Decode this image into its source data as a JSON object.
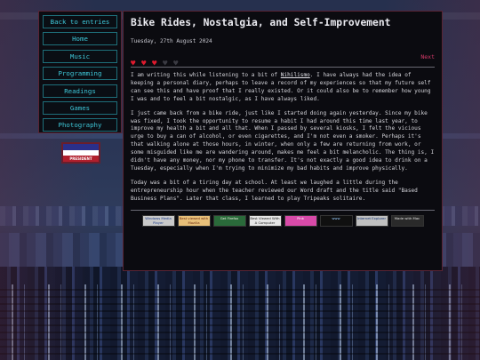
{
  "sidebar": {
    "items": [
      {
        "label": "Back to entries"
      },
      {
        "label": "Home"
      },
      {
        "label": "Music"
      },
      {
        "label": "Programming"
      },
      {
        "label": "Readings"
      },
      {
        "label": "Games"
      },
      {
        "label": "Photography"
      }
    ],
    "badge_text": "PRESIDENT"
  },
  "post": {
    "title": "Bike Rides, Nostalgia, and Self-Improvement",
    "date": "Tuesday, 27th August 2024",
    "rating": {
      "filled": 3,
      "total": 5
    },
    "next_label": "Next",
    "p1_a": "I am writing this while listening to a bit of ",
    "p1_link": "Nihilismo",
    "p1_b": ". I have always had the idea of keeping a personal diary, perhaps to leave a record of my experiences so that my future self can see this and have proof that I really existed. Or it could also be to remember how young I was and to feel a bit nostalgic, as I have always liked.",
    "p2": "I just came back from a bike ride, just like I started doing again yesterday. Since my bike was fixed, I took the opportunity to resume a habit I had around this time last year, to improve my health a bit and all that. When I passed by several kiosks, I felt the vicious urge to buy a can of alcohol, or even cigarettes, and I'm not even a smoker. Perhaps it's that walking alone at those hours, in winter, when only a few are returning from work, or some misguided like me are wandering around, makes me feel a bit melancholic. The thing is, I didn't have any money, nor my phone to transfer. It's not exactly a good idea to drink on a Tuesday, especially when I'm trying to minimize my bad habits and improve physically.",
    "p3": "Today was a bit of a tiring day at school. At least we laughed a little during the entrepreneurship hour when the teacher reviewed our Word draft and the title said \"Based Business Plans\". Later that class, I learned to play Tripeaks solitaire."
  },
  "footer_buttons": [
    {
      "label": "Windows Media Player",
      "icon": "windows-media-badge"
    },
    {
      "label": "Best viewed with Mozilla",
      "icon": "mozilla-badge"
    },
    {
      "label": "Get Firefox",
      "icon": "firefox-badge"
    },
    {
      "label": "Best Viewed With A Computer Monitor",
      "icon": "monitor-badge"
    },
    {
      "label": "Pink",
      "icon": "pink-badge"
    },
    {
      "label": "www",
      "icon": "www-badge"
    },
    {
      "label": "Internet Explorer",
      "icon": "ie-badge"
    },
    {
      "label": "Made with Mac",
      "icon": "mac-badge"
    }
  ],
  "colors": {
    "accent_cyan": "#3ec7d8",
    "heart_on": "#e01a2e",
    "next_link": "#d83a6a",
    "border": "#5a2434"
  }
}
